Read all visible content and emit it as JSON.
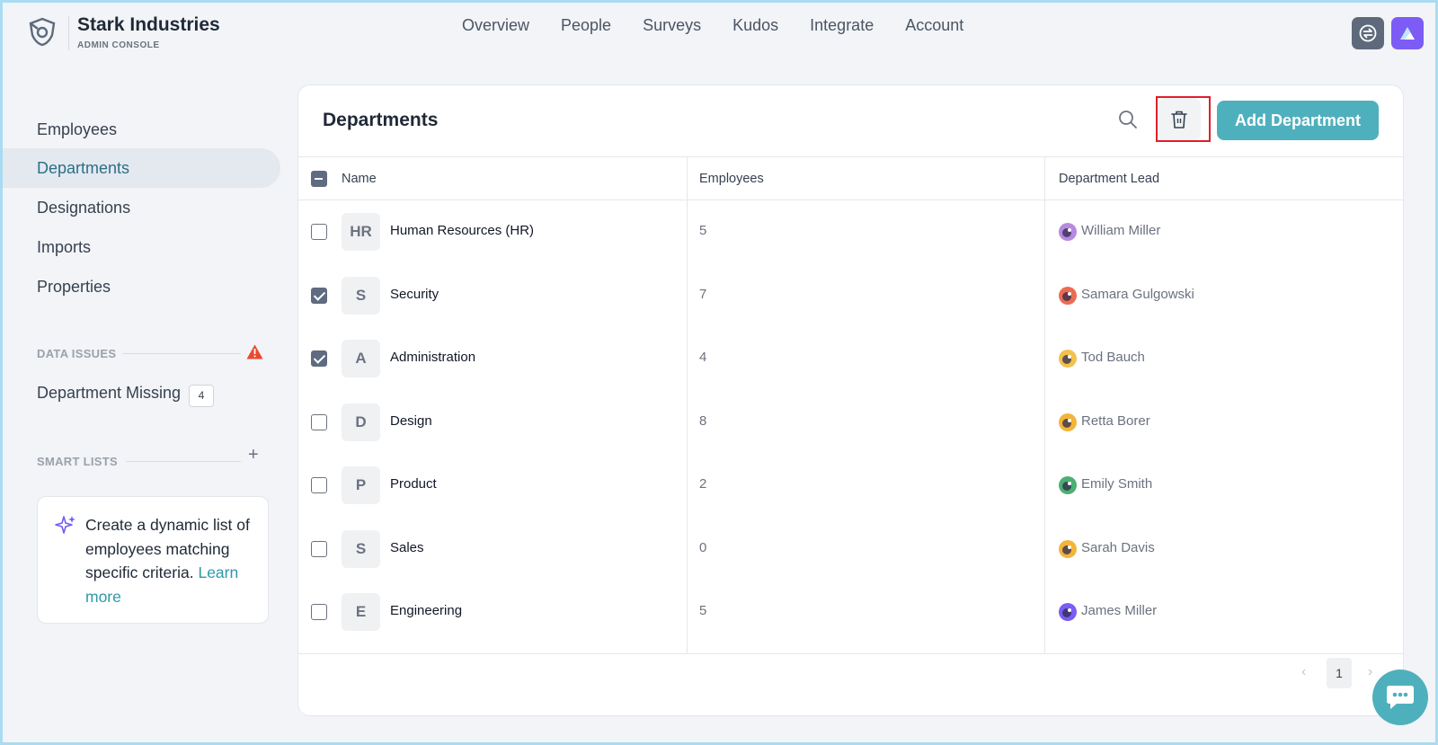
{
  "brand": {
    "name": "Stark Industries",
    "subtitle": "ADMIN CONSOLE"
  },
  "nav": [
    "Overview",
    "People",
    "Surveys",
    "Kudos",
    "Integrate",
    "Account"
  ],
  "sidebar": {
    "items": [
      {
        "label": "Employees",
        "active": false
      },
      {
        "label": "Departments",
        "active": true
      },
      {
        "label": "Designations",
        "active": false
      },
      {
        "label": "Imports",
        "active": false
      },
      {
        "label": "Properties",
        "active": false
      }
    ],
    "data_issues": {
      "title": "DATA ISSUES",
      "item_label": "Department Missing",
      "count": "4"
    },
    "smart_lists": {
      "title": "SMART LISTS",
      "card_text": "Create a dynamic list of employees matching specific criteria.",
      "link_text": "Learn more"
    }
  },
  "main": {
    "title": "Departments",
    "add_button": "Add Department",
    "columns": [
      "Name",
      "Employees",
      "Department Lead"
    ],
    "rows": [
      {
        "initial": "HR",
        "name": "Human Resources (HR)",
        "employees": "5",
        "lead": "William Miller",
        "checked": false,
        "avatar_color": "#b889e0"
      },
      {
        "initial": "S",
        "name": "Security",
        "employees": "7",
        "lead": "Samara Gulgowski",
        "checked": true,
        "avatar_color": "#ec6b52"
      },
      {
        "initial": "A",
        "name": "Administration",
        "employees": "4",
        "lead": "Tod Bauch",
        "checked": true,
        "avatar_color": "#f2c14e"
      },
      {
        "initial": "D",
        "name": "Design",
        "employees": "8",
        "lead": "Retta Borer",
        "checked": false,
        "avatar_color": "#f2b53a"
      },
      {
        "initial": "P",
        "name": "Product",
        "employees": "2",
        "lead": "Emily Smith",
        "checked": false,
        "avatar_color": "#4caf74"
      },
      {
        "initial": "S",
        "name": "Sales",
        "employees": "0",
        "lead": "Sarah Davis",
        "checked": false,
        "avatar_color": "#f2b53a"
      },
      {
        "initial": "E",
        "name": "Engineering",
        "employees": "5",
        "lead": "James Miller",
        "checked": false,
        "avatar_color": "#7c5cf5"
      }
    ],
    "pagination": {
      "current_page": "1",
      "prev_icon": "chevron-left-icon",
      "next_icon": "chevron-right-icon"
    }
  },
  "colors": {
    "accent": "#4fb0bd",
    "active_text": "#2c6f88",
    "warning": "#e8492f",
    "highlight": "#e01e2a"
  }
}
